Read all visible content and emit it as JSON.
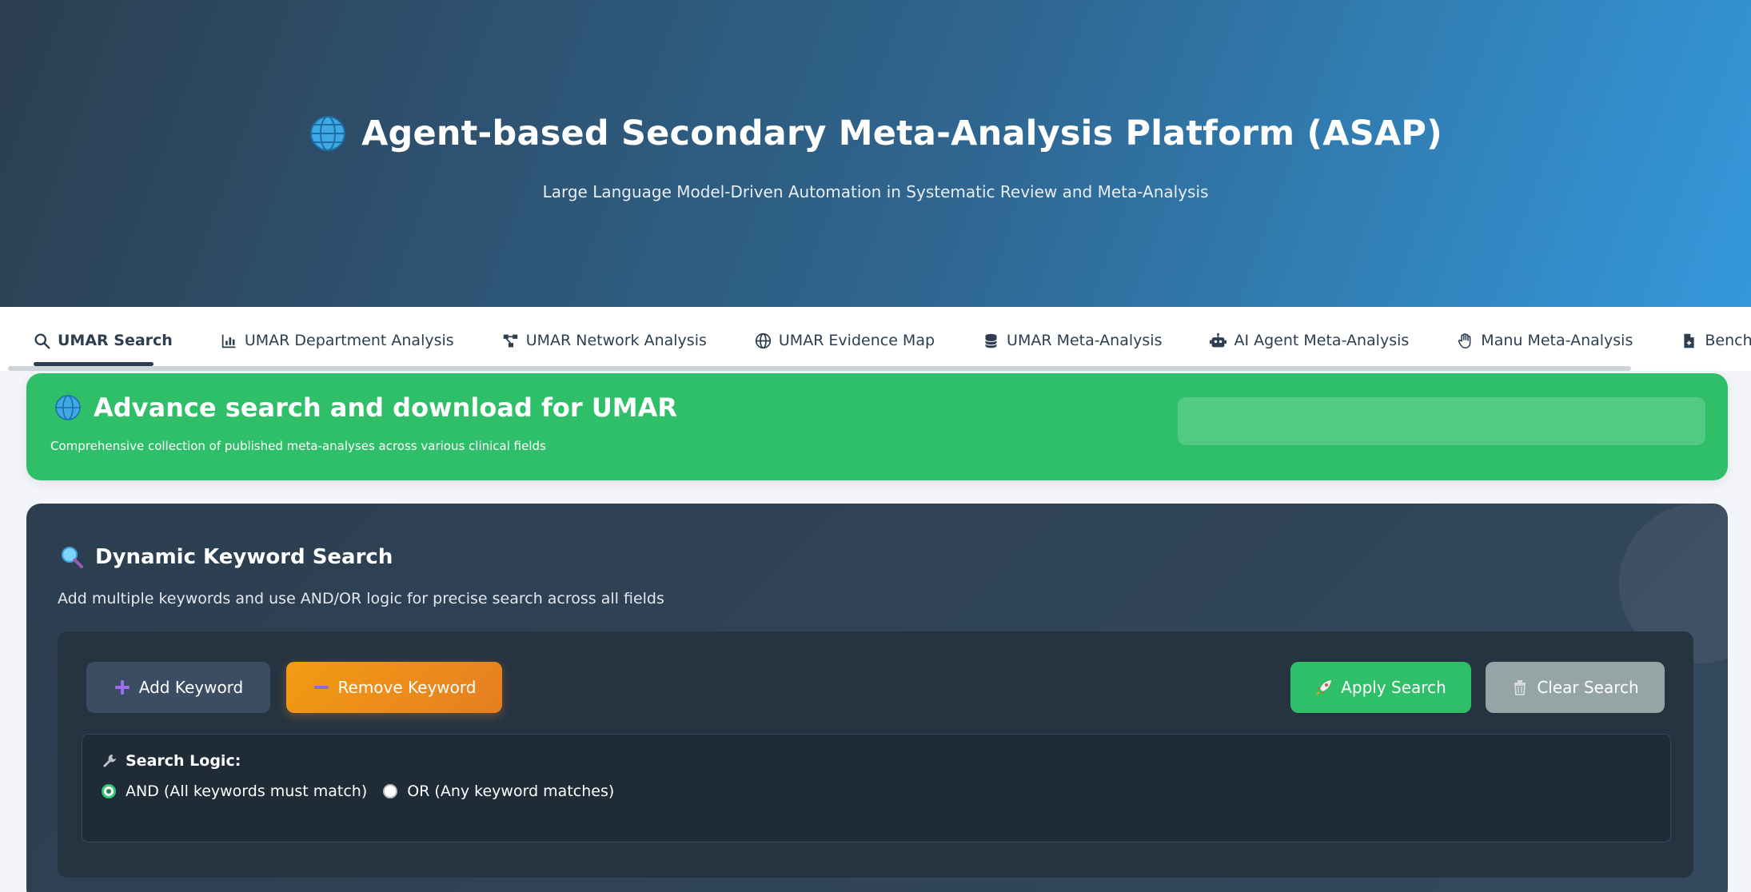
{
  "header": {
    "title": "Agent-based Secondary Meta-Analysis Platform (ASAP)",
    "subtitle": "Large Language Model-Driven Automation in Systematic Review and Meta-Analysis",
    "icon": "globe-icon"
  },
  "tabs": [
    {
      "label": "UMAR Search",
      "icon": "search-icon",
      "active": true
    },
    {
      "label": "UMAR Department Analysis",
      "icon": "bar-chart-icon",
      "active": false
    },
    {
      "label": "UMAR Network Analysis",
      "icon": "network-icon",
      "active": false
    },
    {
      "label": "UMAR Evidence Map",
      "icon": "globe-icon",
      "active": false
    },
    {
      "label": "UMAR Meta-Analysis",
      "icon": "database-icon",
      "active": false
    },
    {
      "label": "AI Agent Meta-Analysis",
      "icon": "robot-icon",
      "active": false
    },
    {
      "label": "Manu Meta-Analysis",
      "icon": "hand-icon",
      "active": false
    },
    {
      "label": "Benchmark",
      "icon": "file-icon",
      "active": false
    }
  ],
  "banner": {
    "title": "Advance search and download for UMAR",
    "subtitle": "Comprehensive collection of published meta-analyses across various clinical fields"
  },
  "search_panel": {
    "title": "Dynamic Keyword Search",
    "subtitle": "Add multiple keywords and use AND/OR logic for precise search across all fields",
    "add_label": "Add Keyword",
    "remove_label": "Remove Keyword",
    "apply_label": "Apply Search",
    "clear_label": "Clear Search",
    "logic_label": "Search Logic:",
    "and_label": "AND (All keywords must match)",
    "or_label": "OR (Any keyword matches)",
    "selected_logic": "AND"
  },
  "colors": {
    "primary_dark": "#2c3e50",
    "accent_blue": "#3498db",
    "success_green": "#2ebf68",
    "warning_orange": "#f39c12",
    "muted_gray": "#95a5a6"
  }
}
